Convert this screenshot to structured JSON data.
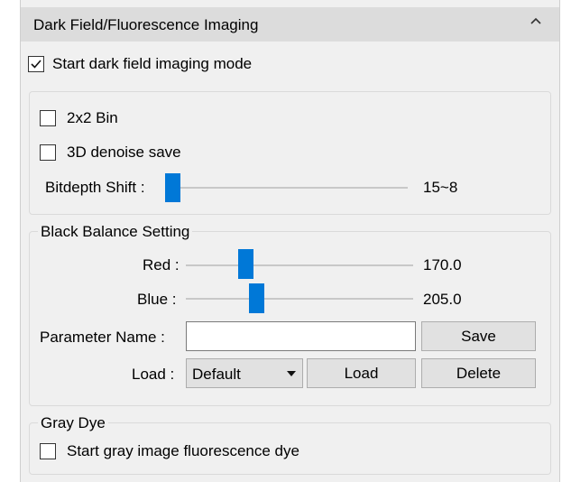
{
  "panel": {
    "title": "Dark Field/Fluorescence Imaging",
    "collapse_icon": "chevron-up-icon"
  },
  "dark_field": {
    "label": "Start dark field imaging mode",
    "checked": true
  },
  "processing": {
    "bin_label": "2x2 Bin",
    "bin_checked": false,
    "denoise_label": "3D denoise save",
    "denoise_checked": false,
    "bitdepth_label": "Bitdepth Shift :",
    "bitdepth_value": "15~8",
    "bitdepth_level": 0.0
  },
  "black_balance": {
    "title": "Black Balance Setting",
    "red_label": "Red :",
    "red_value": "170.0",
    "red_level": 0.25,
    "blue_label": "Blue :",
    "blue_value": "205.0",
    "blue_level": 0.31,
    "param_label": "Parameter Name :",
    "param_value": "",
    "save_label": "Save",
    "load_label": "Load :",
    "load_selected": "Default",
    "load_button": "Load",
    "delete_button": "Delete"
  },
  "gray_dye": {
    "title": "Gray Dye",
    "label": "Start gray image fluorescence dye",
    "checked": false
  },
  "colors": {
    "accent": "#0078d7",
    "header_bg": "#dcdcdc",
    "panel_bg": "#f0f0f0"
  }
}
